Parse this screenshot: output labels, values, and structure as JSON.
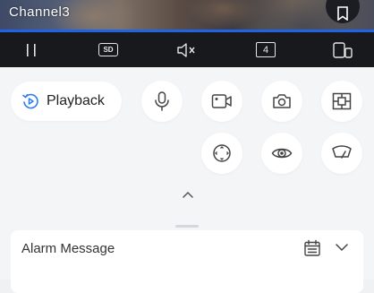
{
  "video": {
    "channel_label": "Channel3"
  },
  "control_bar": {
    "quality_label": "SD",
    "split_count": "4"
  },
  "panel": {
    "playback_label": "Playback",
    "alarm_title": "Alarm Message"
  },
  "colors": {
    "accent": "#1f63e6",
    "control_bar_bg": "#18191c",
    "panel_bg": "#f4f5f7"
  },
  "icons": [
    "bookmark-icon",
    "pause-icon",
    "mute-icon",
    "device-switch-icon",
    "playback-icon",
    "microphone-icon",
    "record-icon",
    "camera-icon",
    "multi-view-icon",
    "ptz-icon",
    "eye-icon",
    "wiper-icon",
    "chevron-up-icon",
    "calendar-icon",
    "chevron-down-icon"
  ]
}
